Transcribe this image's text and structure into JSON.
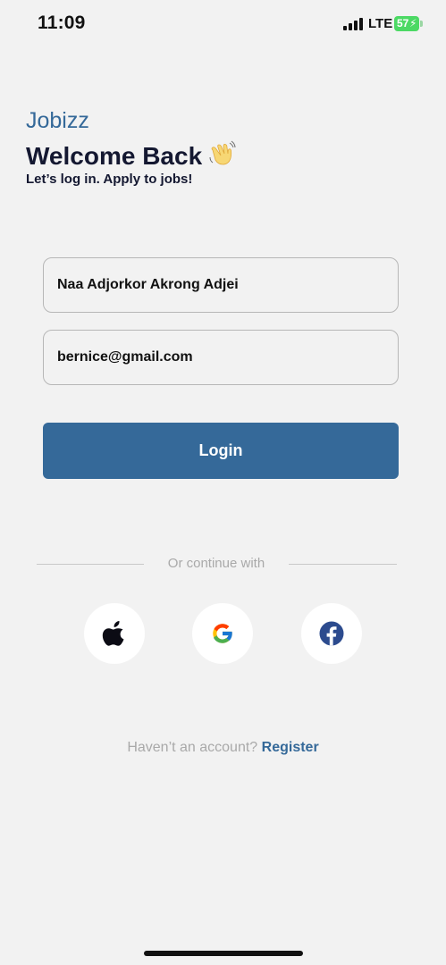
{
  "status_bar": {
    "time": "11:09",
    "network": "LTE",
    "battery": "57"
  },
  "header": {
    "brand": "Jobizz",
    "title": "Welcome Back",
    "subtitle": "Let’s log in. Apply to jobs!"
  },
  "form": {
    "name_value": "Naa Adjorkor Akrong Adjei",
    "email_value": "bernice@gmail.com",
    "login_label": "Login"
  },
  "divider": {
    "text": "Or continue with"
  },
  "social": [
    "apple-icon",
    "google-icon",
    "facebook-icon"
  ],
  "register": {
    "prompt": "Haven’t an account?",
    "link": "Register"
  },
  "colors": {
    "accent": "#356999",
    "title": "#141831",
    "background": "#f2f2f2",
    "muted": "#a9a9a9"
  }
}
